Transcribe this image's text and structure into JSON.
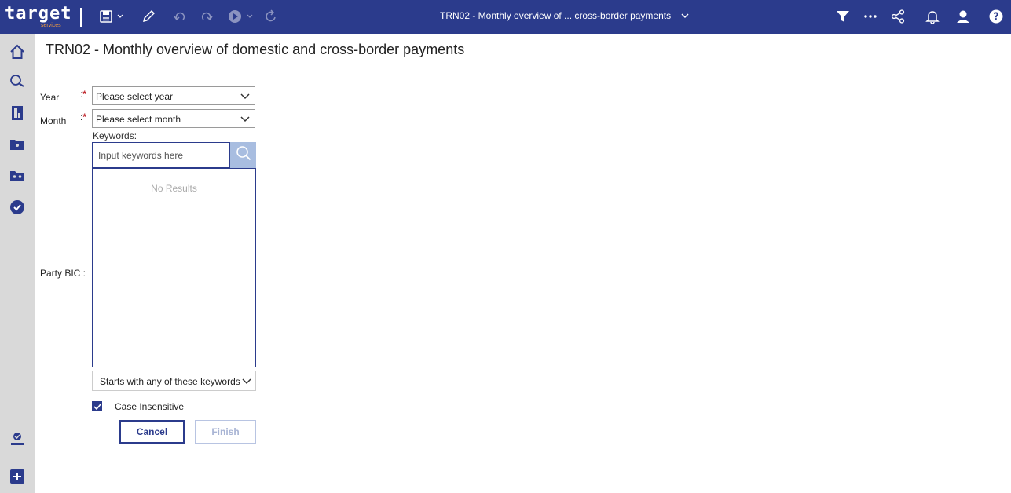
{
  "app": {
    "logo_text": "target",
    "logo_sub": "services",
    "document_title": "TRN02 - Monthly overview of ... cross-border payments",
    "toolbar_icons": [
      "save-icon",
      "chevron-down-icon",
      "pencil-icon",
      "undo-icon",
      "redo-icon",
      "play-icon",
      "chevron-down-icon",
      "refresh-icon"
    ],
    "right_icons": [
      "filter-icon",
      "more-icon",
      "share-icon",
      "bell-icon",
      "user-icon",
      "help-icon"
    ],
    "colors": {
      "brand": "#2b3b8c",
      "required": "#c0262d",
      "search_button": "#a8bde0"
    }
  },
  "sidebar": {
    "items": [
      "home-icon",
      "search-icon",
      "document-icon",
      "folder-icon",
      "shared-folder-icon",
      "check-icon"
    ],
    "bottom_items": [
      "user-badge-icon",
      "plus-icon"
    ]
  },
  "page": {
    "title": "TRN02 - Monthly overview of domestic and cross-border payments"
  },
  "form": {
    "year_label": "Year",
    "month_label": "Month",
    "colon": ":",
    "required_mark": "*",
    "year_placeholder": "Please select year",
    "month_placeholder": "Please select month",
    "party_bic_label": "Party BIC :",
    "keywords_label": "Keywords:",
    "keywords_placeholder": "Input keywords here",
    "no_results": "No Results",
    "match_mode": "Starts with any of these keywords",
    "case_insensitive_label": "Case Insensitive",
    "case_insensitive_checked": true,
    "cancel_label": "Cancel",
    "finish_label": "Finish"
  }
}
